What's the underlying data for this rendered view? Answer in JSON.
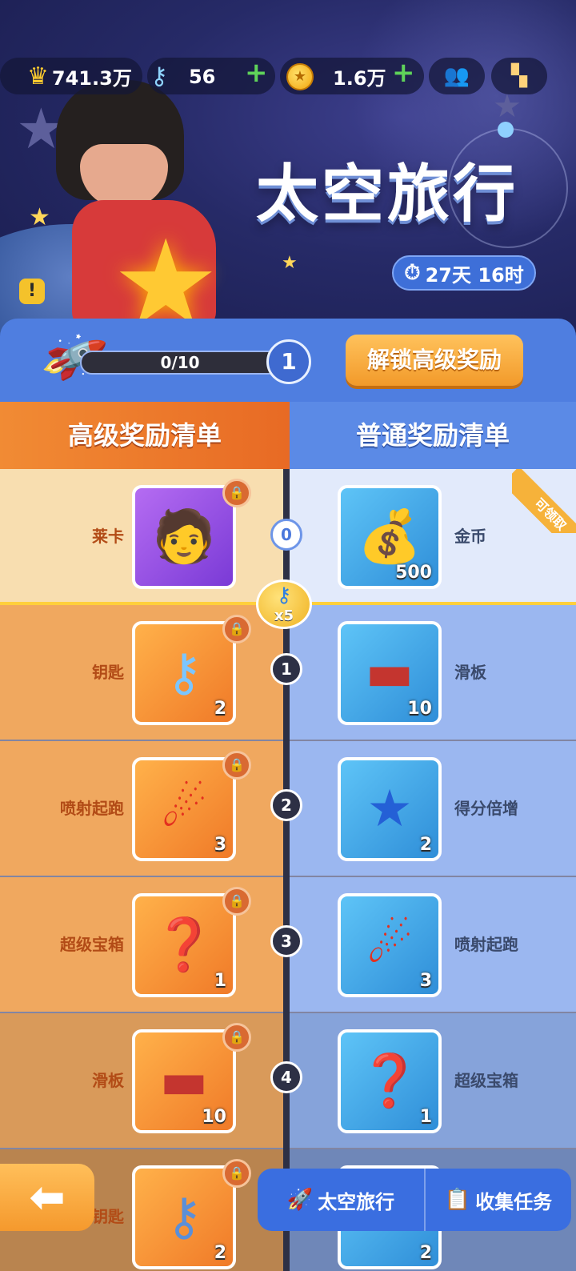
{
  "resources": {
    "crown_value": "741.3万",
    "keys_value": "56",
    "coins_value": "1.6万",
    "plus": "+"
  },
  "event": {
    "title": "太空旅行",
    "timer": "27天 16时",
    "info_icon": "!"
  },
  "progress": {
    "text": "0/10",
    "fraction": 0,
    "level": "1",
    "unlock_label": "解锁高级奖励"
  },
  "columns": {
    "premium_title": "高级奖励清单",
    "normal_title": "普通奖励清单"
  },
  "claimable_ribbon": "可领取",
  "key_bubble": "x5",
  "rows": [
    {
      "tier": "0",
      "premium": {
        "name": "莱卡",
        "qty": ""
      },
      "normal": {
        "name": "金币",
        "qty": "500"
      }
    },
    {
      "tier": "1",
      "premium": {
        "name": "钥匙",
        "qty": "2"
      },
      "normal": {
        "name": "滑板",
        "qty": "10"
      }
    },
    {
      "tier": "2",
      "premium": {
        "name": "喷射起跑",
        "qty": "3"
      },
      "normal": {
        "name": "得分倍增",
        "qty": "2"
      }
    },
    {
      "tier": "3",
      "premium": {
        "name": "超级宝箱",
        "qty": "1"
      },
      "normal": {
        "name": "喷射起跑",
        "qty": "3"
      }
    },
    {
      "tier": "4",
      "premium": {
        "name": "滑板",
        "qty": "10"
      },
      "normal": {
        "name": "超级宝箱",
        "qty": "1"
      }
    },
    {
      "tier": "",
      "premium": {
        "name": "钥匙",
        "qty": "2"
      },
      "normal": {
        "name": "",
        "qty": "2"
      }
    }
  ],
  "bottom_nav": {
    "tab_space_travel": "太空旅行",
    "tab_collect_tasks": "收集任务"
  },
  "colors": {
    "premium_accent": "#f18b34",
    "normal_accent": "#5b8ae6",
    "unlock_button": "#f5a83a"
  }
}
